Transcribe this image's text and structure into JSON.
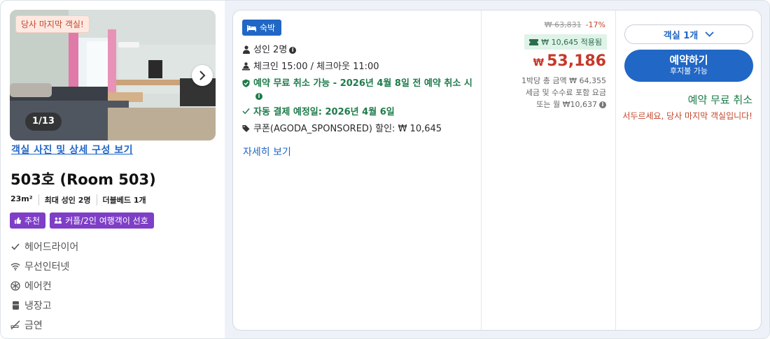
{
  "photo": {
    "badge": "당사 마지막 객실!",
    "counter": "1/13",
    "link": "객실 사진 및 상세 구성 보기"
  },
  "room": {
    "title": "503호 (Room 503)",
    "size": "23m²",
    "occupancy": "최대 성인 2명",
    "bed": "더블베드 1개",
    "badges": [
      "추천",
      "커플/2인 여행객이 선호"
    ],
    "amenities": [
      {
        "icon": "check-icon",
        "label": "헤어드라이어"
      },
      {
        "icon": "wifi-icon",
        "label": "무선인터넷"
      },
      {
        "icon": "snowflake-icon",
        "label": "에어컨"
      },
      {
        "icon": "fridge-icon",
        "label": "냉장고"
      },
      {
        "icon": "no-smoking-icon",
        "label": "금연"
      }
    ]
  },
  "offer": {
    "type": "숙박",
    "guests": "성인 2명",
    "checkin": "체크인 15:00 / 체크아웃 11:00",
    "free_cancel": "예약 무료 취소 가능 - 2026년 4월 8일 전 예약 취소 시",
    "auto_pay": "자동 결제 예정일: 2026년 4월 6일",
    "coupon": "쿠폰(AGODA_SPONSORED) 할인: ₩ 10,645",
    "details_link": "자세히 보기"
  },
  "price": {
    "original": "₩ 63,831",
    "discount": "-17%",
    "applied": "₩ 10,645 적용됨",
    "currency": "₩",
    "final": "53,186",
    "note1": "1박당 총 금액 ₩ 64,355",
    "note2": "세금 및 수수료 포함 요금",
    "note3": "또는 월 ₩10,637"
  },
  "booking": {
    "room_select": "객실 1개",
    "book_label": "예약하기",
    "book_sub": "후지불 가능",
    "free_cancel": "예약 무료 취소",
    "hurry": "서두르세요, 당사 마지막 객실입니다!"
  },
  "colors": {
    "accent": "#2167c5",
    "price": "#c6382a",
    "green": "#1e7b4a",
    "purple": "#7e3ec6"
  }
}
